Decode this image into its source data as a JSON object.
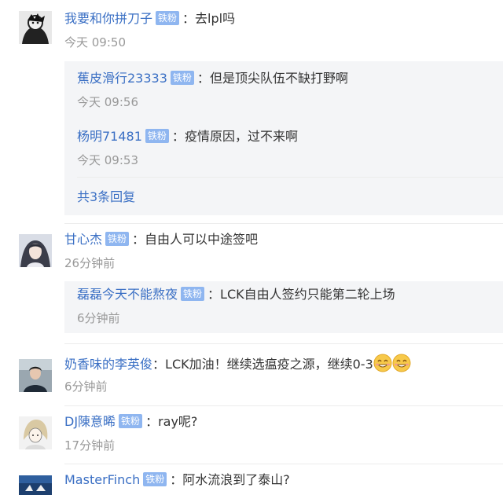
{
  "comments": [
    {
      "user": "我要和你拼刀子",
      "badge": "铁粉",
      "text": "去lpl吗",
      "time": "今天 09:50",
      "replies": [
        {
          "user": "蕉皮滑行23333",
          "badge": "铁粉",
          "text": "但是顶尖队伍不缺打野啊",
          "time": "今天 09:56"
        },
        {
          "user": "杨明71481",
          "badge": "铁粉",
          "text": "疫情原因，过不来啊",
          "time": "今天 09:53"
        }
      ],
      "more_replies": "共3条回复"
    },
    {
      "user": "甘心杰",
      "badge": "铁粉",
      "text": "自由人可以中途签吧",
      "time": "26分钟前",
      "replies": [
        {
          "user": "磊磊今天不能熬夜",
          "badge": "铁粉",
          "text": "LCK自由人签约只能第二轮上场",
          "time": "6分钟前"
        }
      ]
    },
    {
      "user": "奶香味的李英俊",
      "text": "LCK加油！继续选瘟疫之源，继续0-3",
      "emoji": "smile-emoji",
      "time": "6分钟前"
    },
    {
      "user": "DJ陳意晞",
      "badge": "铁粉",
      "text": "ray呢?",
      "time": "17分钟前"
    },
    {
      "user": "MasterFinch",
      "badge": "铁粉",
      "text": "阿水流浪到了泰山?"
    }
  ],
  "colors": {
    "username": "#3a6fc4",
    "badge_bg": "#8fb6f0",
    "time": "#999999",
    "reply_bg": "#f4f5f7"
  }
}
